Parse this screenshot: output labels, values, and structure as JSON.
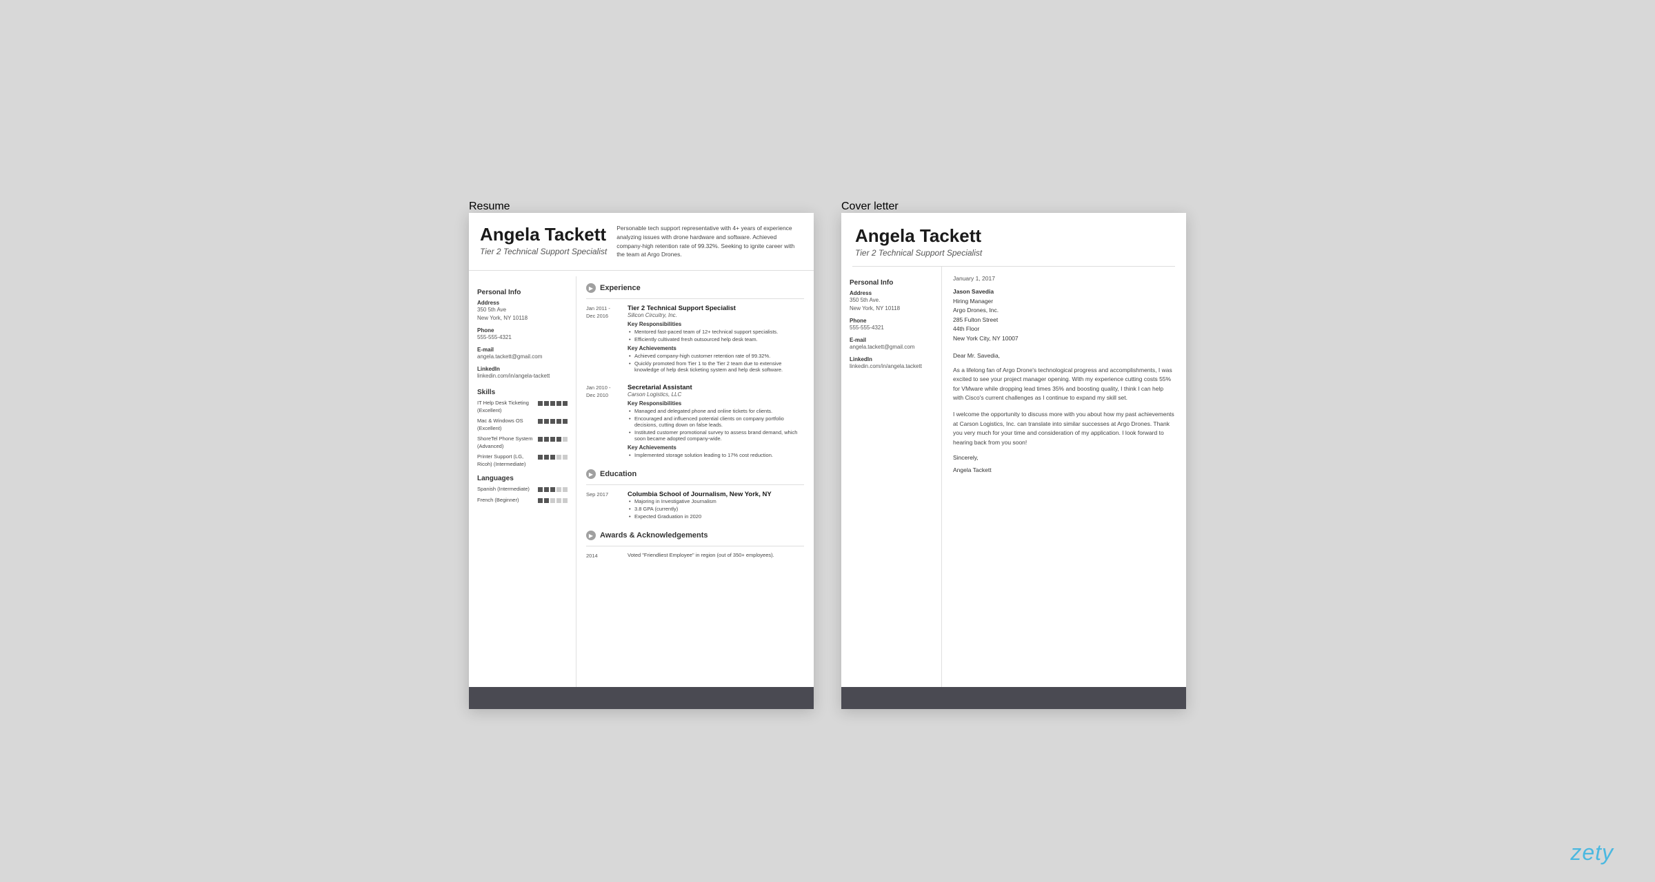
{
  "resume": {
    "tab_label": "Resume",
    "name": "Angela Tackett",
    "title": "Tier 2 Technical Support Specialist",
    "summary": "Personable tech support representative with 4+ years of experience analyzing issues with drone hardware and software. Achieved company-high retention rate of 99.32%. Seeking to ignite career with the team at Argo Drones.",
    "personal_info_label": "Personal Info",
    "address_label": "Address",
    "address_lines": [
      "350 5th Ave",
      "New York, NY 10118"
    ],
    "phone_label": "Phone",
    "phone": "555-555-4321",
    "email_label": "E-mail",
    "email": "angela.tackett@gmail.com",
    "linkedin_label": "LinkedIn",
    "linkedin": "linkedin.com/in/angela-tackett",
    "skills_label": "Skills",
    "skills": [
      {
        "name": "IT Help Desk Ticketing (Excellent)",
        "dots": 5,
        "filled": 5
      },
      {
        "name": "Mac & Windows OS (Excellent)",
        "dots": 5,
        "filled": 5
      },
      {
        "name": "ShoreTel Phone System (Advanced)",
        "dots": 5,
        "filled": 4
      },
      {
        "name": "Printer Support (LG, Ricoh) (Intermediate)",
        "dots": 5,
        "filled": 3
      }
    ],
    "languages_label": "Languages",
    "languages": [
      {
        "name": "Spanish (Intermediate)",
        "dots": 5,
        "filled": 3
      },
      {
        "name": "French (Beginner)",
        "dots": 5,
        "filled": 2
      }
    ],
    "experience_label": "Experience",
    "experiences": [
      {
        "date_start": "Jan 2011 -",
        "date_end": "Dec 2016",
        "job_title": "Tier 2 Technical Support Specialist",
        "company": "Silicon Circuitry, Inc.",
        "responsibilities_label": "Key Responsibilities",
        "responsibilities": [
          "Mentored fast-paced team of 12+ technical support specialists.",
          "Efficiently cultivated fresh outsourced help desk team."
        ],
        "achievements_label": "Key Achievements",
        "achievements": [
          "Achieved company-high customer retention rate of 99.32%.",
          "Quickly promoted from Tier 1 to the Tier 2 team due to extensive knowledge of help desk ticketing system and help desk software."
        ]
      },
      {
        "date_start": "Jan 2010 -",
        "date_end": "Dec 2010",
        "job_title": "Secretarial Assistant",
        "company": "Carson Logistics, LLC",
        "responsibilities_label": "Key Responsibilities",
        "responsibilities": [
          "Managed and delegated phone and online tickets for clients.",
          "Encouraged and influenced potential clients on company portfolio decisions, cutting down on false leads.",
          "Instituted customer promotional survey to assess brand demand, which soon became adopted company-wide."
        ],
        "achievements_label": "Key Achievements",
        "achievements": [
          "Implemented storage solution leading to 17% cost reduction."
        ]
      }
    ],
    "education_label": "Education",
    "educations": [
      {
        "date": "Sep 2017",
        "school": "Columbia School of Journalism, New York, NY",
        "bullets": [
          "Majoring in Investigative Journalism",
          "3.8 GPA (currently)",
          "Expected Graduation in 2020"
        ]
      }
    ],
    "awards_label": "Awards & Acknowledgements",
    "awards": [
      {
        "year": "2014",
        "description": "Voted \"Friendliest Employee\" in region (out of 350+ employees)."
      }
    ]
  },
  "cover_letter": {
    "tab_label": "Cover letter",
    "name": "Angela Tackett",
    "title": "Tier 2 Technical Support Specialist",
    "personal_info_label": "Personal Info",
    "address_label": "Address",
    "address_lines": [
      "350 5th Ave.",
      "New York, NY 10118"
    ],
    "phone_label": "Phone",
    "phone": "555-555-4321",
    "email_label": "E-mail",
    "email": "angela.tackett@gmail.com",
    "linkedin_label": "LinkedIn",
    "linkedin": "linkedin.com/in/angela.tackett",
    "date": "January 1, 2017",
    "recipient_name": "Jason Savedia",
    "recipient_title": "Hiring Manager",
    "recipient_company": "Argo Drones, Inc.",
    "recipient_address": "285 Fulton Street",
    "recipient_floor": "44th Floor",
    "recipient_city": "New York City, NY 10007",
    "greeting": "Dear Mr. Savedia,",
    "paragraph1": "As a lifelong fan of Argo Drone's technological progress and accomplishments, I was excited to see your project manager opening. With my experience cutting costs 55% for VMware while dropping lead times 35% and boosting quality, I think I can help with Cisco's current challenges as I continue to expand my skill set.",
    "paragraph2": "I welcome the opportunity to discuss more with you about how my past achievements at Carson Logistics, Inc. can translate into similar successes at Argo Drones. Thank you very much for your time and consideration of my application. I look forward to hearing back from you soon!",
    "closing": "Sincerely,",
    "signature": "Angela Tackett"
  },
  "zety_logo": "zety"
}
